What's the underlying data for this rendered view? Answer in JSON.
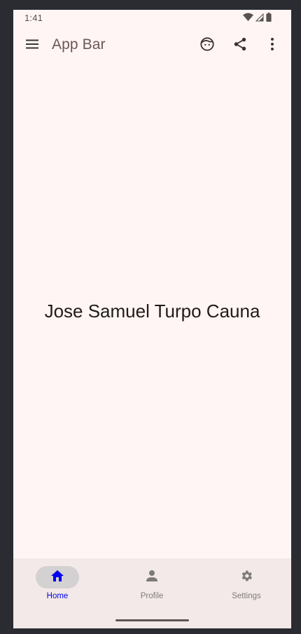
{
  "status_bar": {
    "time": "1:41",
    "icons": [
      "wifi-icon",
      "signal-icon",
      "battery-icon"
    ]
  },
  "app_bar": {
    "title": "App Bar",
    "actions": [
      "menu-icon",
      "face-icon",
      "share-icon",
      "more-vert-icon"
    ]
  },
  "content": {
    "text": "Jose Samuel Turpo Cauna"
  },
  "bottom_nav": {
    "items": [
      {
        "label": "Home",
        "icon": "home-icon",
        "selected": true
      },
      {
        "label": "Profile",
        "icon": "person-icon",
        "selected": false
      },
      {
        "label": "Settings",
        "icon": "gear-icon",
        "selected": false
      }
    ]
  },
  "colors": {
    "background": "#fff5f4",
    "nav_background": "#f3e9e8",
    "active_nav": "#0000ee",
    "active_pill": "#d3d1d1",
    "title": "#6d5754"
  }
}
